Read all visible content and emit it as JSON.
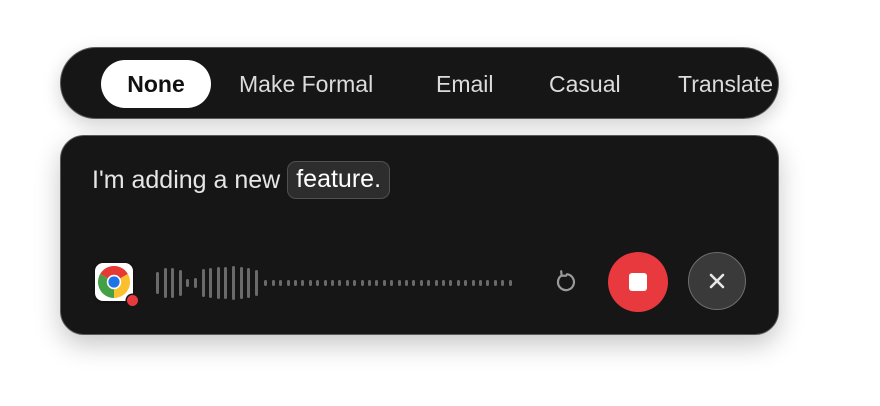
{
  "modes": {
    "tabs": [
      {
        "label": "None",
        "active": true
      },
      {
        "label": "Make Formal",
        "active": false
      },
      {
        "label": "Email",
        "active": false
      },
      {
        "label": "Casual",
        "active": false
      },
      {
        "label": "Translate",
        "active": false
      }
    ]
  },
  "dictation": {
    "text": "I'm adding a new",
    "highlight": "feature.",
    "app_icon": "chrome-icon",
    "recording": true,
    "controls": {
      "redo_icon": "redo-icon",
      "stop_icon": "stop-icon",
      "close_icon": "close-icon"
    }
  },
  "colors": {
    "panel": "#161616",
    "active_tab": "#ffffff",
    "stop_button": "#e8393f",
    "recording_indicator": "#e8393f"
  }
}
